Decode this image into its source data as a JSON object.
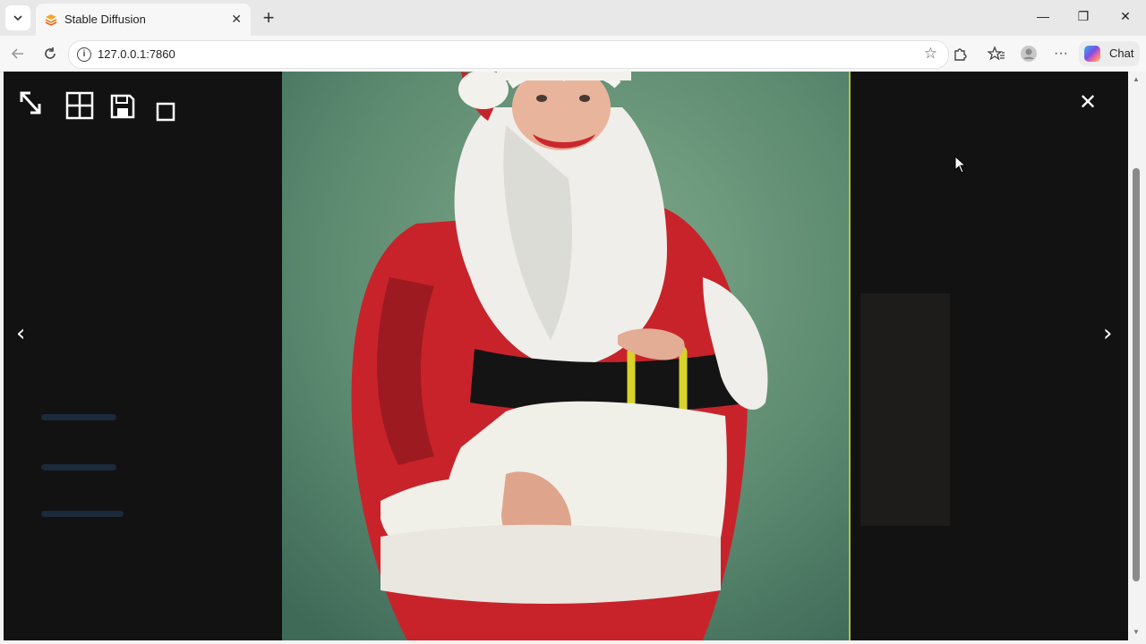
{
  "browser": {
    "tab_title": "Stable Diffusion",
    "url": "127.0.0.1:7860",
    "chat_label": "Chat"
  },
  "lightbox": {
    "prev_glyph": "‹",
    "next_glyph": "›",
    "close_glyph": "✕"
  },
  "colors": {
    "background": "#121212",
    "image_background": "#5f8d72",
    "separator": "#b9bf3a"
  }
}
